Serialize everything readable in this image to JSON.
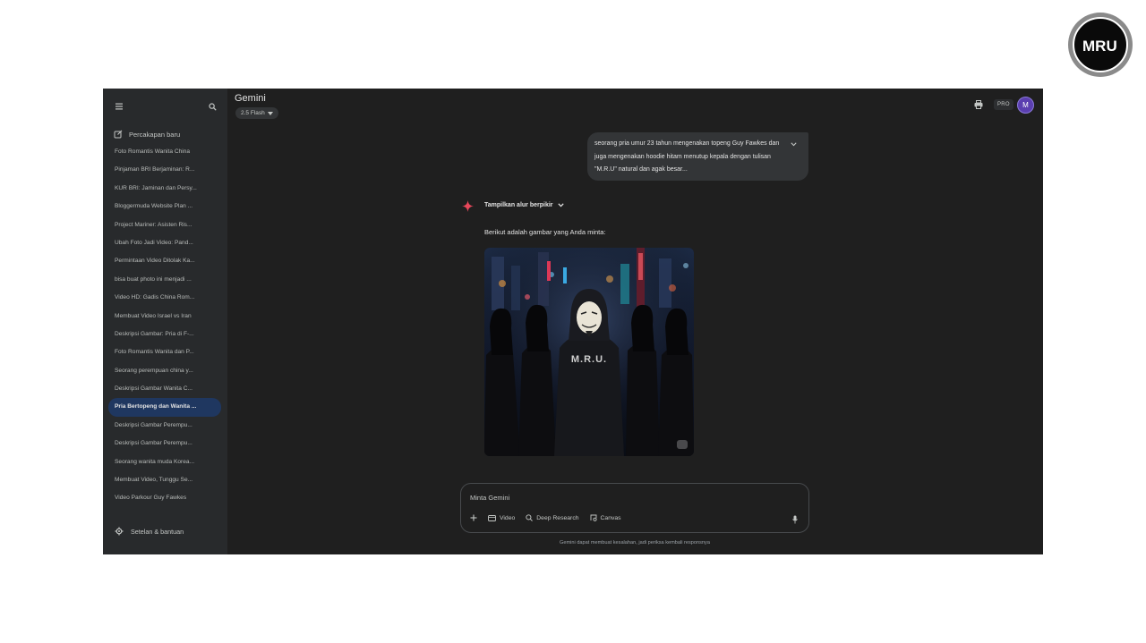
{
  "logo": {
    "text": "MRU"
  },
  "sidebar": {
    "new_chat_label": "Percakapan baru",
    "recent": [
      {
        "label": "Foto Romantis Wanita China",
        "active": false
      },
      {
        "label": "Pinjaman BRI Berjaminan: R...",
        "active": false
      },
      {
        "label": "KUR BRI: Jaminan dan Persy...",
        "active": false
      },
      {
        "label": "Bloggermuda Website Plan ...",
        "active": false
      },
      {
        "label": "Project Mariner: Asisten Ris...",
        "active": false
      },
      {
        "label": "Ubah Foto Jadi Video: Pand...",
        "active": false
      },
      {
        "label": "Permintaan Video Ditolak Ka...",
        "active": false
      },
      {
        "label": "bisa buat photo ini menjadi ...",
        "active": false
      },
      {
        "label": "Video HD: Gadis China Rom...",
        "active": false
      },
      {
        "label": "Membuat Video Israel vs Iran",
        "active": false
      },
      {
        "label": "Deskripsi Gambar: Pria di F-...",
        "active": false
      },
      {
        "label": "Foto Romantis Wanita dan P...",
        "active": false
      },
      {
        "label": "Seorang perempuan china y...",
        "active": false
      },
      {
        "label": "Deskripsi Gambar Wanita C...",
        "active": false
      },
      {
        "label": "Pria Bertopeng dan Wanita ...",
        "active": true
      },
      {
        "label": "Deskripsi Gambar Perempu...",
        "active": false
      },
      {
        "label": "Deskripsi Gambar Perempu...",
        "active": false
      },
      {
        "label": "Seorang wanita muda Korea...",
        "active": false
      },
      {
        "label": "Membuat Video, Tunggu Se...",
        "active": false
      },
      {
        "label": "Video Parkour Guy Fawkes",
        "active": false
      }
    ],
    "settings_label": "Setelan & bantuan"
  },
  "header": {
    "title": "Gemini",
    "model": "2.5 Flash",
    "pro_label": "PRO",
    "avatar_initial": "M"
  },
  "chat": {
    "user_message": "seorang pria umur 23 tahun mengenakan topeng Guy Fawkes dan juga mengenakan hoodie hitam menutup kepala dengan tulisan \"M.R.U\" natural dan agak besar...",
    "thinking_label": "Tampilkan alur berpikir",
    "response_text": "Berikut adalah gambar yang Anda minta:",
    "image": {
      "hoodie_text": "M.R.U."
    }
  },
  "composer": {
    "placeholder": "Minta Gemini",
    "tools": {
      "video": "Video",
      "deep_research": "Deep Research",
      "canvas": "Canvas"
    },
    "disclaimer": "Gemini dapat membuat kesalahan, jadi periksa kembali responsnya"
  },
  "colors": {
    "app_bg": "#1f1f1f",
    "sidebar_bg": "#282a2c",
    "active_item": "#1f3760",
    "spark": "#e8475a",
    "avatar": "#5b3fb0"
  }
}
